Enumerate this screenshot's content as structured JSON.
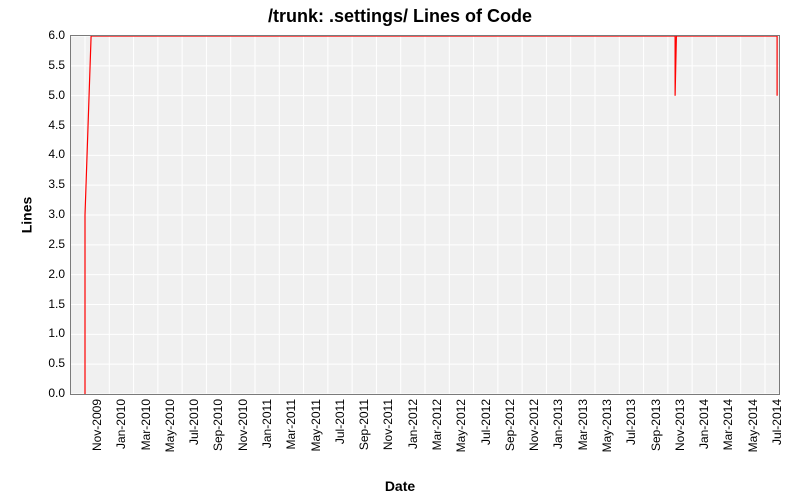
{
  "chart_data": {
    "type": "line",
    "title": "/trunk: .settings/ Lines of Code",
    "xlabel": "Date",
    "ylabel": "Lines",
    "ylim": [
      0.0,
      6.0
    ],
    "ytick_labels": [
      "0.0",
      "0.5",
      "1.0",
      "1.5",
      "2.0",
      "2.5",
      "3.0",
      "3.5",
      "4.0",
      "4.5",
      "5.0",
      "5.5",
      "6.0"
    ],
    "xtick_labels": [
      "Nov-2009",
      "Jan-2010",
      "Mar-2010",
      "May-2010",
      "Jul-2010",
      "Sep-2010",
      "Nov-2010",
      "Jan-2011",
      "Mar-2011",
      "May-2011",
      "Jul-2011",
      "Sep-2011",
      "Nov-2011",
      "Jan-2012",
      "Mar-2012",
      "May-2012",
      "Jul-2012",
      "Sep-2012",
      "Nov-2012",
      "Jan-2013",
      "Mar-2013",
      "May-2013",
      "Jul-2013",
      "Sep-2013",
      "Nov-2013",
      "Jan-2014",
      "Mar-2014",
      "May-2014",
      "Jul-2014"
    ],
    "series": [
      {
        "name": "lines",
        "color": "#ff0000",
        "points": [
          {
            "xi": 0.0,
            "y": 0.0
          },
          {
            "xi": 0.0,
            "y": 3.0
          },
          {
            "xi": 0.25,
            "y": 6.0
          },
          {
            "xi": 24.3,
            "y": 6.0
          },
          {
            "xi": 24.3,
            "y": 5.0
          },
          {
            "xi": 24.35,
            "y": 6.0
          },
          {
            "xi": 28.5,
            "y": 6.0
          },
          {
            "xi": 28.5,
            "y": 5.0
          }
        ]
      }
    ]
  }
}
